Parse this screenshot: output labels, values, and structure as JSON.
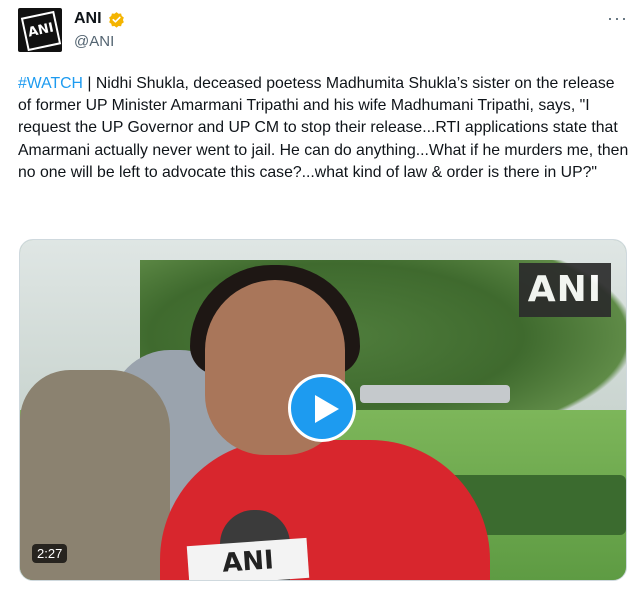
{
  "account": {
    "name": "ANI",
    "handle": "@ANI",
    "avatar_text": "ANI",
    "verified_badge_color": "#f4b400"
  },
  "more_menu_label": "···",
  "tweet": {
    "hashtag": "#WATCH",
    "body": " | Nidhi Shukla, deceased poetess Madhumita Shukla’s sister on the release of former UP Minister Amarmani Tripathi and his wife Madhumani Tripathi, says, \"I request the UP Governor and UP CM to stop their release...RTI applications state that Amarmani actually never went to jail. He can do anything...What if he murders me, then no one will be left to advocate this case?...what kind of law & order is there in UP?\""
  },
  "video": {
    "watermark": "ANI",
    "mic_label": "ANI",
    "duration": "2:27",
    "play_icon": "play-icon"
  },
  "colors": {
    "accent": "#1d9bf0",
    "text": "#0f1419",
    "secondary_text": "#536471"
  }
}
